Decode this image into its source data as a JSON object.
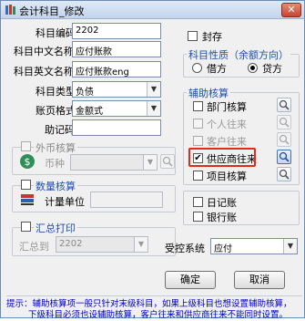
{
  "window": {
    "title": "会计科目_修改",
    "close_glyph": "✕"
  },
  "form": {
    "code_label": "科目编码",
    "code_value": "2202",
    "cn_name_label": "科目中文名称",
    "cn_name_value": "应付账款",
    "en_name_label": "科目英文名称",
    "en_name_value": "应付账款eng",
    "type_label": "科目类型",
    "type_value": "负债",
    "format_label": "账页格式",
    "format_value": "金额式",
    "mnemonic_label": "助记码",
    "mnemonic_value": ""
  },
  "sealed": {
    "label": "封存",
    "checked": false
  },
  "balance_direction": {
    "title": "科目性质（余额方向）",
    "options": [
      {
        "label": "借方",
        "selected": false
      },
      {
        "label": "贷方",
        "selected": true
      }
    ]
  },
  "auxiliary": {
    "title": "辅助核算",
    "items": [
      {
        "label": "部门核算",
        "checked": false,
        "enabled": true,
        "check_glyph": ""
      },
      {
        "label": "个人往来",
        "checked": false,
        "enabled": false,
        "check_glyph": ""
      },
      {
        "label": "客户往来",
        "checked": false,
        "enabled": false,
        "check_glyph": ""
      },
      {
        "label": "供应商往来",
        "checked": true,
        "enabled": true,
        "check_glyph": "✔"
      },
      {
        "label": "项目核算",
        "checked": false,
        "enabled": true,
        "check_glyph": ""
      }
    ]
  },
  "foreign_currency": {
    "title": "外币核算",
    "currency_label": "币种",
    "currency_value": ""
  },
  "quantity": {
    "title": "数量核算",
    "unit_label": "计量单位",
    "unit_value": ""
  },
  "summary_print": {
    "title": "汇总打印",
    "to_label": "汇总到",
    "to_value": "2202"
  },
  "journals": {
    "daily": "日记账",
    "bank": "银行账"
  },
  "recon": {
    "label": "受控系统",
    "value": "应付"
  },
  "buttons": {
    "ok": "确定",
    "cancel": "取消"
  },
  "hint": {
    "line1": "提示：辅助核算项一般只针对末级科目，如果上级科目也想设置辅助核算，",
    "line2": "下级科目必须也设辅助核算，客户往来和供应商往来不能同时设置。"
  },
  "colors": {
    "legend": "#1e4fa8",
    "hint": "#0000c8",
    "highlight_box": "#e12a1c",
    "title_bar": "#c3d4ec"
  }
}
